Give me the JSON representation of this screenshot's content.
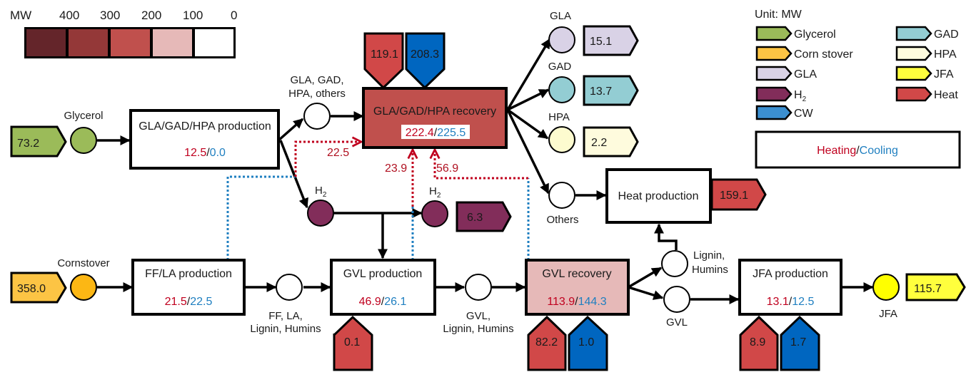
{
  "scale": {
    "unit_label": "MW",
    "ticks": [
      "400",
      "300",
      "200",
      "100",
      "0"
    ],
    "bins": [
      {
        "range": "400+",
        "color": "#64252a"
      },
      {
        "range": "300-400",
        "color": "#943838"
      },
      {
        "range": "200-300",
        "color": "#c0504d"
      },
      {
        "range": "100-200",
        "color": "#e6b9b8"
      },
      {
        "range": "0-100",
        "color": "#ffffff"
      }
    ]
  },
  "legend": {
    "unit": "Unit: MW",
    "items": [
      {
        "label": "Glycerol",
        "color": "#9bbb59"
      },
      {
        "label": "Corn stover",
        "color": "#fcc444"
      },
      {
        "label": "GLA",
        "color": "#d9d2e6"
      },
      {
        "label": "H",
        "sub": "2",
        "color": "#822d5a"
      },
      {
        "label": "CW",
        "color": "#3b8fd0"
      },
      {
        "label": "GAD",
        "color": "#93cdd3"
      },
      {
        "label": "HPA",
        "color": "#fefbdd"
      },
      {
        "label": "JFA",
        "color": "#ffff3d"
      },
      {
        "label": "Heat",
        "color": "#d14848"
      }
    ],
    "box": {
      "heating": "Heating",
      "sep": "/",
      "cooling": "Cooling"
    }
  },
  "colors": {
    "heating_text": "#c0001e",
    "cooling_text": "#1f7fc0",
    "heat_stream": "#d14848",
    "cw_stream": "#0066c0"
  },
  "feeds": [
    {
      "id": "glycerol",
      "value": "73.2",
      "label": "Glycerol"
    },
    {
      "id": "cornstover",
      "value": "358.0",
      "label": "Cornstover"
    }
  ],
  "units": [
    {
      "id": "gla-prod",
      "title": "GLA/GAD/HPA production",
      "heating": "12.5",
      "cooling": "0.0"
    },
    {
      "id": "gla-rec",
      "title": "GLA/GAD/HPA recovery",
      "heating": "222.4",
      "cooling": "225.5"
    },
    {
      "id": "heat-prod",
      "title": "Heat production"
    },
    {
      "id": "ffla-prod",
      "title": "FF/LA production",
      "heating": "21.5",
      "cooling": "22.5"
    },
    {
      "id": "gvl-prod",
      "title": "GVL production",
      "heating": "46.9",
      "cooling": "26.1"
    },
    {
      "id": "gvl-rec",
      "title": "GVL recovery",
      "heating": "113.9",
      "cooling": "144.3"
    },
    {
      "id": "jfa-prod",
      "title": "JFA production",
      "heating": "13.1",
      "cooling": "12.5"
    }
  ],
  "streams": {
    "gla_gad_hpa_others": "GLA, GAD,\nHPA, others",
    "gla_gad_hpa_others_l1": "GLA, GAD,",
    "gla_gad_hpa_others_l2": "HPA, others",
    "h2_a": "H",
    "h2_b": "H",
    "h2_sub": "2",
    "gla": "GLA",
    "gad": "GAD",
    "hpa": "HPA",
    "others": "Others",
    "ffla_l1": "FF, LA,",
    "ffla_l2": "Lignin, Humins",
    "gvl_l1": "GVL,",
    "gvl_l2": "Lignin, Humins",
    "lignin_l1": "Lignin,",
    "lignin_l2": "Humins",
    "gvl": "GVL",
    "jfa": "JFA"
  },
  "products": {
    "gla": "15.1",
    "gad": "13.7",
    "hpa": "2.2",
    "h2": "6.3",
    "heat": "159.1",
    "jfa": "115.7"
  },
  "utilities": {
    "gla_rec_heat": "119.1",
    "gla_rec_cw": "208.3",
    "gvl_prod_heat": "0.1",
    "gvl_rec_heat": "82.2",
    "gvl_rec_cw": "1.0",
    "jfa_prod_heat": "8.9",
    "jfa_prod_cw": "1.7"
  },
  "heat_integration": {
    "to_gla_rec_from_ffla": "22.5",
    "to_gla_rec_from_gvl_prod": "23.9",
    "to_gla_rec_from_gvl_rec": "56.9"
  }
}
